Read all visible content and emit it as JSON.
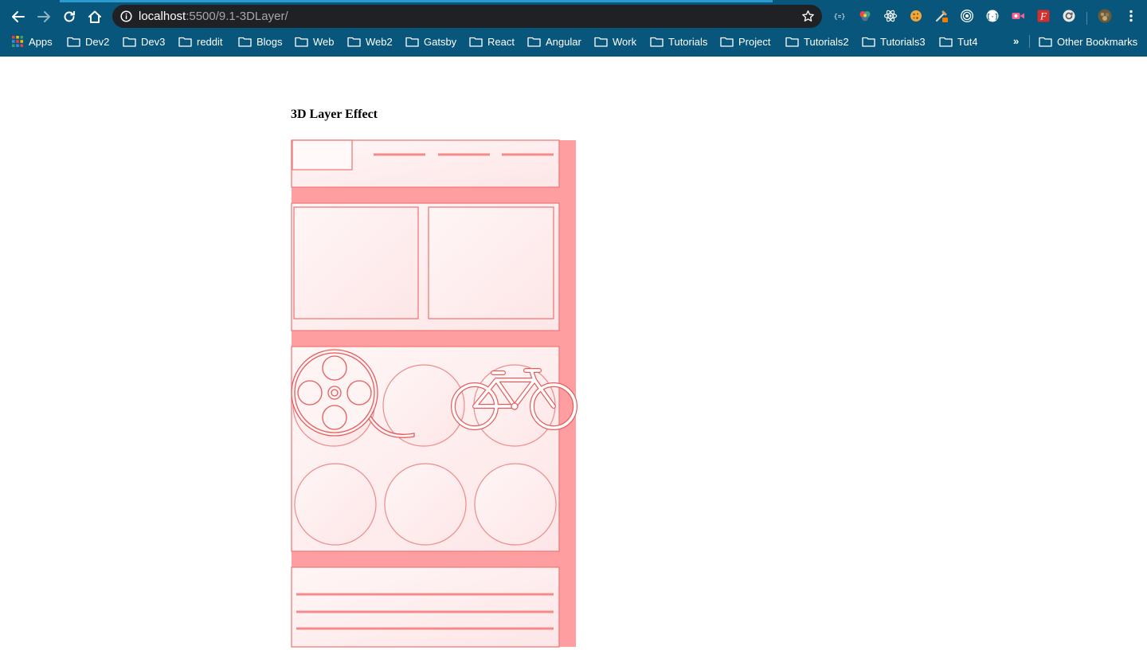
{
  "browser": {
    "url_host": "localhost",
    "url_path": ":5500/9.1-3DLayer/",
    "icons": {
      "back": "arrow-left-icon",
      "forward": "arrow-right-icon",
      "reload": "reload-icon",
      "home": "home-icon",
      "info": "info-icon",
      "bookmark": "star-icon",
      "menu": "kebab-menu-icon"
    },
    "extensions": [
      "json-viewer-icon",
      "color-wheel-icon",
      "react-devtools-icon",
      "cookie-icon",
      "eyedropper-icon",
      "target-icon",
      "bracket-icon",
      "video-icon",
      "font-icon",
      "refresh-ext-icon"
    ],
    "colors": {
      "chrome": "#08567b",
      "omnibox": "#202124"
    }
  },
  "bookmarks": {
    "items": [
      {
        "label": "Apps",
        "icon": "apps-grid-icon"
      },
      {
        "label": "Dev2",
        "icon": "folder-icon"
      },
      {
        "label": "Dev3",
        "icon": "folder-icon"
      },
      {
        "label": "reddit",
        "icon": "folder-icon"
      },
      {
        "label": "Blogs",
        "icon": "folder-icon"
      },
      {
        "label": "Web",
        "icon": "folder-icon"
      },
      {
        "label": "Web2",
        "icon": "folder-icon"
      },
      {
        "label": "Gatsby",
        "icon": "folder-icon"
      },
      {
        "label": "React",
        "icon": "folder-icon"
      },
      {
        "label": "Angular",
        "icon": "folder-icon"
      },
      {
        "label": "Work",
        "icon": "folder-icon"
      },
      {
        "label": "Tutorials",
        "icon": "folder-icon"
      },
      {
        "label": "Project",
        "icon": "folder-icon"
      },
      {
        "label": "Tutorials2",
        "icon": "folder-icon"
      },
      {
        "label": "Tutorials3",
        "icon": "folder-icon"
      },
      {
        "label": "Tut4",
        "icon": "folder-icon"
      }
    ],
    "more": "»",
    "other": "Other Bookmarks"
  },
  "page": {
    "title": "3D Layer Effect",
    "illustration": {
      "icons": [
        "film-reel-icon",
        "bicycle-icon"
      ],
      "colors": {
        "stroke": "#f07a7a",
        "back_layer": "#ff9ea0",
        "panel": "#fdeeee"
      }
    }
  }
}
